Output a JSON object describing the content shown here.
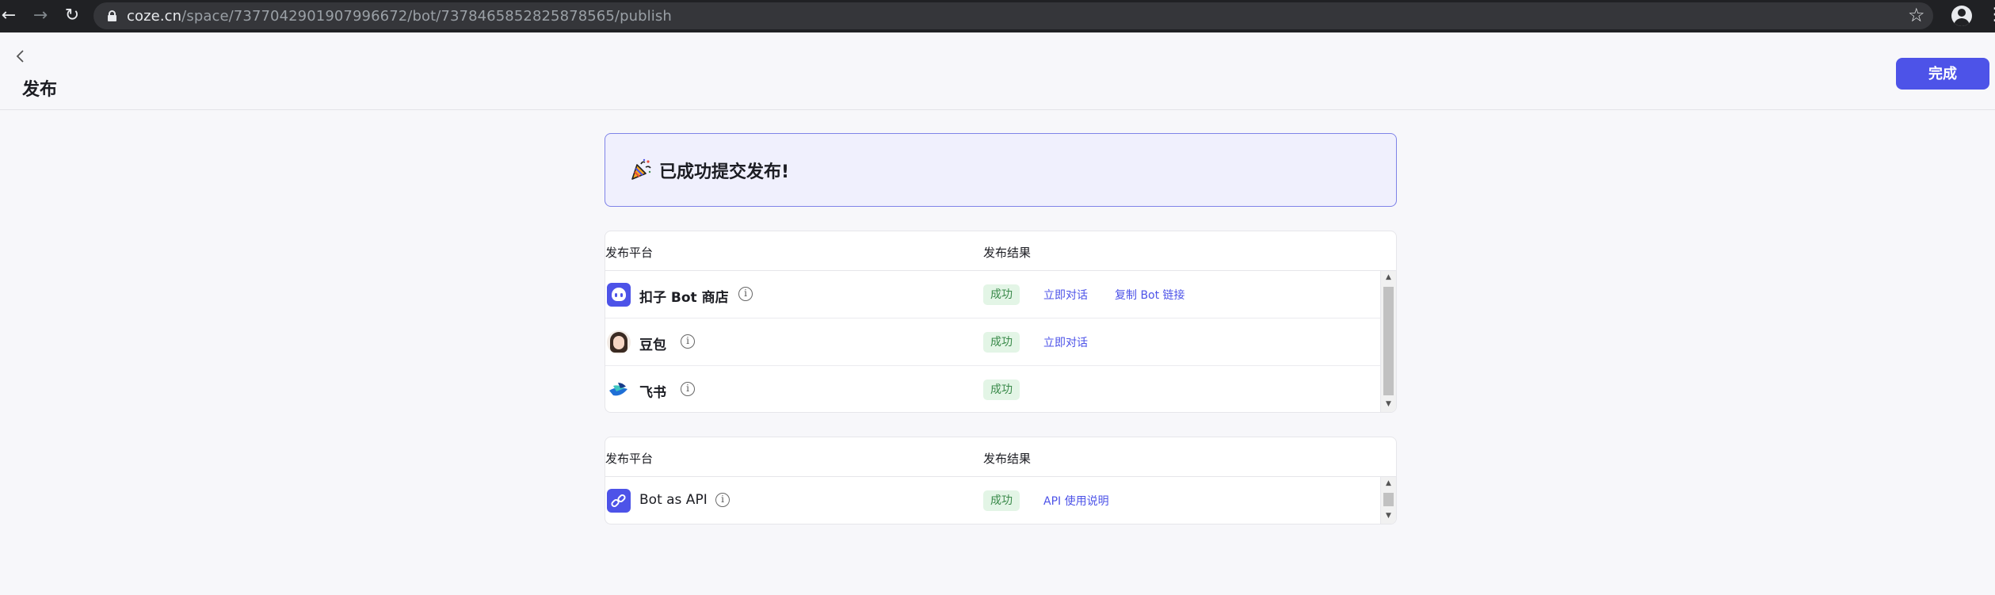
{
  "browser": {
    "url_host": "coze.cn",
    "url_path": "/space/7377042901907996672/bot/7378465852825878565/publish"
  },
  "header": {
    "title": "发布",
    "done_label": "完成"
  },
  "banner": {
    "message": "已成功提交发布!"
  },
  "table1": {
    "col_platform": "发布平台",
    "col_result": "发布结果",
    "rows": [
      {
        "name": "扣子 Bot 商店",
        "status": "成功",
        "link1": "立即对话",
        "link2": "复制 Bot 链接"
      },
      {
        "name": "豆包",
        "status": "成功",
        "link1": "立即对话"
      },
      {
        "name": "飞书",
        "status": "成功"
      }
    ]
  },
  "table2": {
    "col_platform": "发布平台",
    "col_result": "发布结果",
    "rows": [
      {
        "name": "Bot as API",
        "status": "成功",
        "link1": "API 使用说明"
      }
    ]
  },
  "colors": {
    "accent": "#4d53e8",
    "success_bg": "#e3f5e6",
    "success_text": "#3a8a4a",
    "banner_border": "#7f83e8"
  }
}
